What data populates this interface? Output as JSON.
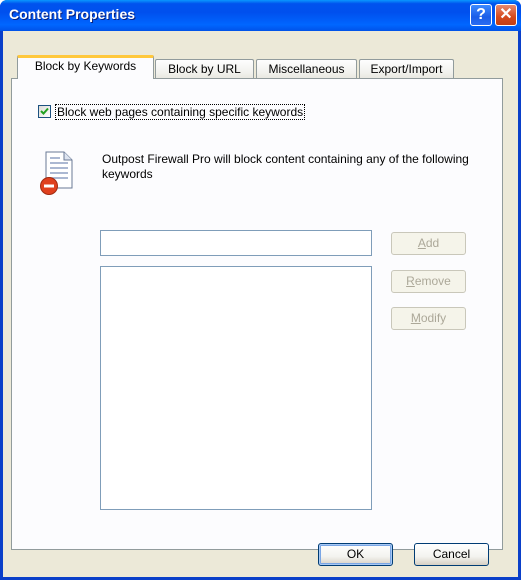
{
  "window": {
    "title": "Content Properties",
    "help_glyph": "?",
    "close_glyph": "✕"
  },
  "tabs": [
    {
      "label": "Block by Keywords",
      "active": true
    },
    {
      "label": "Block by URL",
      "active": false
    },
    {
      "label": "Miscellaneous",
      "active": false
    },
    {
      "label": "Export/Import",
      "active": false
    }
  ],
  "block_keywords": {
    "checkbox_label": "Block web pages containing specific keywords",
    "checked": true,
    "info_text": "Outpost Firewall Pro will block content containing any of the following keywords",
    "keyword_input_value": "",
    "keywords": []
  },
  "buttons": {
    "add": {
      "label_pre": "",
      "label_u": "A",
      "label_post": "dd",
      "enabled": false
    },
    "remove": {
      "label_pre": "",
      "label_u": "R",
      "label_post": "emove",
      "enabled": false
    },
    "modify": {
      "label_pre": "",
      "label_u": "M",
      "label_post": "odify",
      "enabled": false
    },
    "ok": {
      "label": "OK",
      "enabled": true
    },
    "cancel": {
      "label": "Cancel",
      "enabled": true
    }
  },
  "icons": {
    "info": "document-block-icon",
    "check": "checkmark-icon"
  },
  "colors": {
    "titlebar": "#0053ee",
    "active_tab_accent": "#ffc83c",
    "dialog_bg": "#ece9d8"
  }
}
